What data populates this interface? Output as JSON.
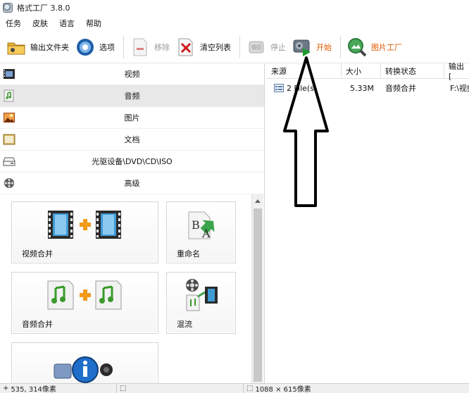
{
  "window": {
    "title": "格式工厂 3.8.0"
  },
  "menu": {
    "items": [
      "任务",
      "皮肤",
      "语言",
      "帮助"
    ]
  },
  "toolbar": {
    "output_folder": "输出文件夹",
    "options": "选项",
    "remove": "移除",
    "clear_list": "清空列表",
    "stop": "停止",
    "start": "开始",
    "picture_factory": "图片工厂"
  },
  "categories": [
    {
      "label": "视频",
      "icon": "video-icon",
      "selected": false
    },
    {
      "label": "音频",
      "icon": "audio-icon",
      "selected": true
    },
    {
      "label": "图片",
      "icon": "picture-icon",
      "selected": false
    },
    {
      "label": "文档",
      "icon": "document-icon",
      "selected": false
    },
    {
      "label": "光驱设备\\DVD\\CD\\ISO",
      "icon": "optical-drive-icon",
      "selected": false
    },
    {
      "label": "高级",
      "icon": "advanced-icon",
      "selected": false
    }
  ],
  "tiles": {
    "video_merge": "视频合并",
    "rename": "重命名",
    "audio_merge": "音频合并",
    "mux": "混流"
  },
  "table": {
    "headers": [
      "来源",
      "大小",
      "转换状态",
      "输出 ["
    ],
    "rows": [
      {
        "source": "2 File(s)",
        "size": "5.33M",
        "status": "音频合并",
        "output": "F:\\视频"
      }
    ]
  },
  "statusbar": {
    "cursor": "535, 314像素",
    "selection": "",
    "size": "1088 × 615像素"
  },
  "colors": {
    "accent_orange": "#e05a00",
    "selected_bg": "#e8e8e8",
    "arrow": "#000000"
  }
}
